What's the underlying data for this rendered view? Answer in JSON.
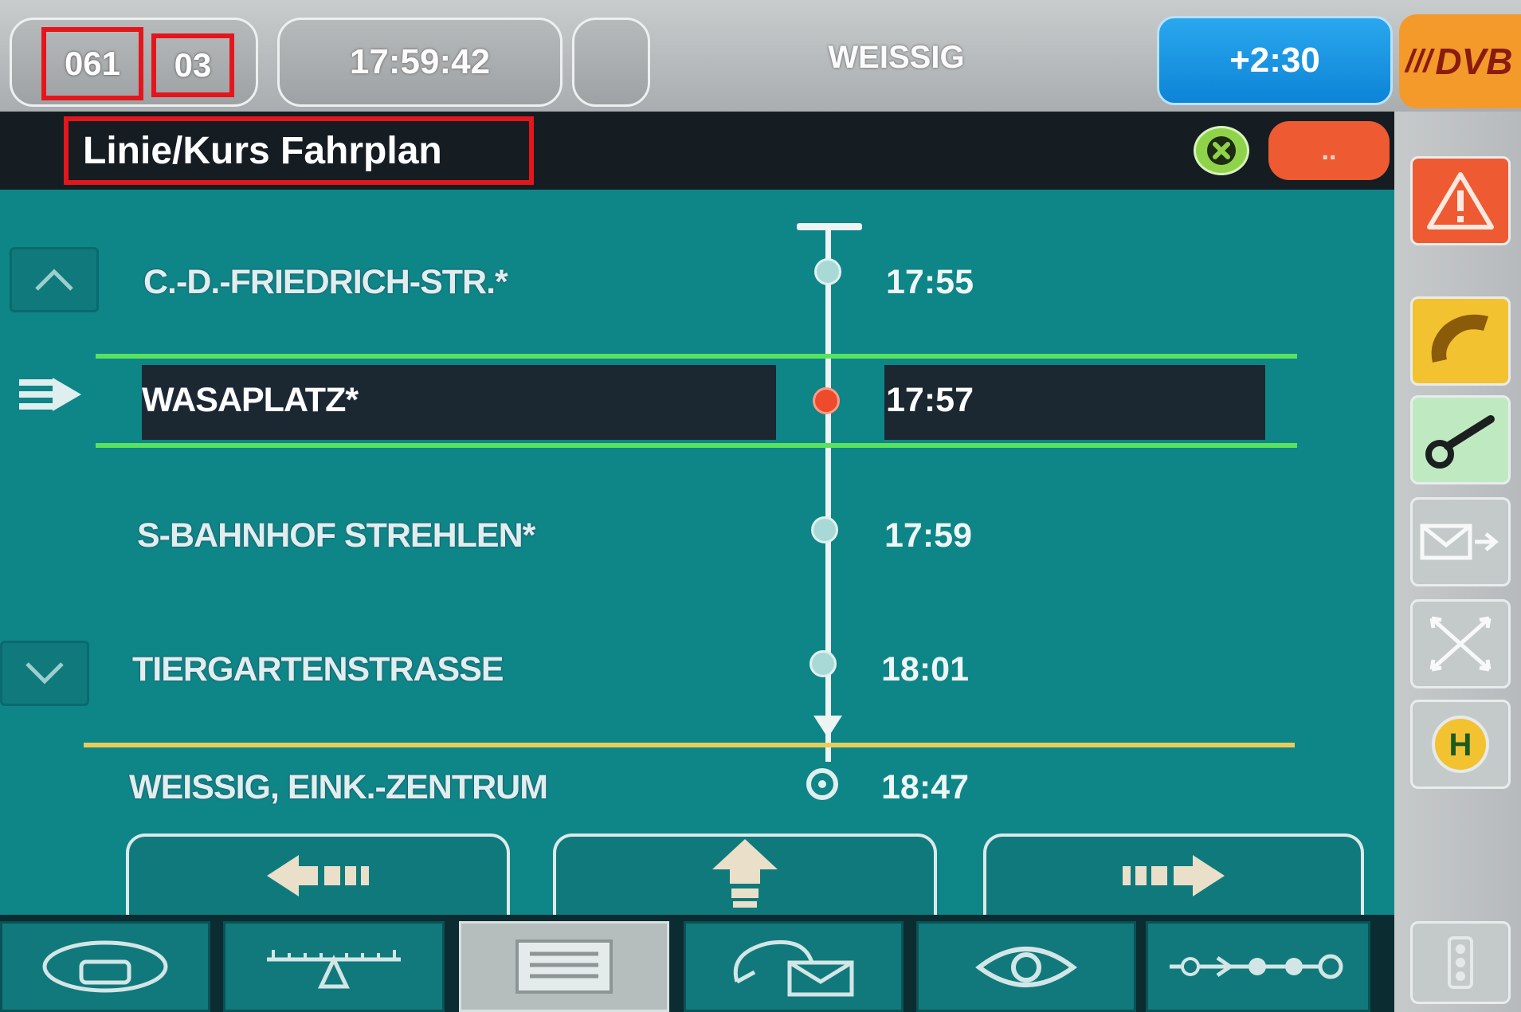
{
  "status_bar": {
    "line": "061",
    "course": "03",
    "clock": "17:59:42",
    "destination": "WEISSIG",
    "delay": "+2:30",
    "logo_text": "DVB"
  },
  "title": {
    "text": "Linie/Kurs Fahrplan",
    "more_label": ".."
  },
  "stops": [
    {
      "name": "C.-D.-FRIEDRICH-STR.*",
      "time": "17:55",
      "state": "passed"
    },
    {
      "name": "WASAPLATZ*",
      "time": "17:57",
      "state": "current"
    },
    {
      "name": "S-BAHNHOF STREHLEN*",
      "time": "17:59",
      "state": "upcoming"
    },
    {
      "name": "TIERGARTENSTRASSE",
      "time": "18:01",
      "state": "upcoming"
    },
    {
      "name": "WEISSIG, EINK.-ZENTRUM",
      "time": "18:47",
      "state": "terminus"
    }
  ],
  "colors": {
    "panel": "#0e8587",
    "highlight": "#59e25e",
    "separator": "#e9cd5a",
    "current_stop": "#ee4a2c",
    "delay_badge": "#0d84d6",
    "warning": "#ee5a32",
    "call": "#f2c230",
    "key": "#bfeac1"
  },
  "sidebar_icons": [
    "warning-icon",
    "phone-icon",
    "key-icon",
    "message-send-icon",
    "network-icon",
    "bus-stop-h-icon",
    "traffic-light-icon"
  ],
  "bottom_tabs": [
    "bus-route-icon",
    "scale-icon",
    "list-icon",
    "chat-mail-icon",
    "eye-icon",
    "route-stops-icon"
  ],
  "nav_buttons": [
    "scroll-left-icon",
    "scroll-up-icon",
    "scroll-right-icon"
  ],
  "h_label": "H"
}
